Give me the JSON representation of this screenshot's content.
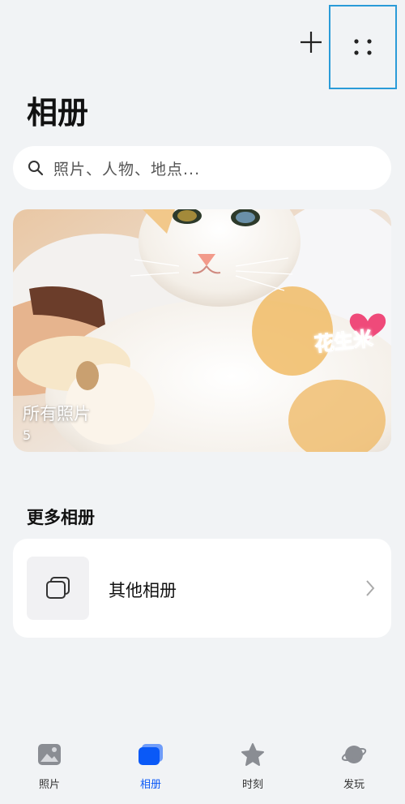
{
  "header": {
    "title": "相册",
    "add_icon": "plus-icon",
    "more_icon": "more-dots-icon"
  },
  "search": {
    "placeholder": "照片、人物、地点..."
  },
  "hero_album": {
    "label": "所有照片",
    "count": "5",
    "sticker_text": "花生米"
  },
  "more_albums": {
    "section_title": "更多相册",
    "items": [
      {
        "label": "其他相册",
        "icon": "albums-stack-icon"
      }
    ]
  },
  "tabbar": {
    "tabs": [
      {
        "label": "照片",
        "icon": "photo-icon",
        "active": false
      },
      {
        "label": "相册",
        "icon": "album-icon",
        "active": true
      },
      {
        "label": "时刻",
        "icon": "star-icon",
        "active": false
      },
      {
        "label": "发玩",
        "icon": "planet-icon",
        "active": false
      }
    ]
  },
  "colors": {
    "background": "#f1f3f5",
    "accent": "#0a59f7",
    "highlight_border": "#2a9bd8"
  }
}
